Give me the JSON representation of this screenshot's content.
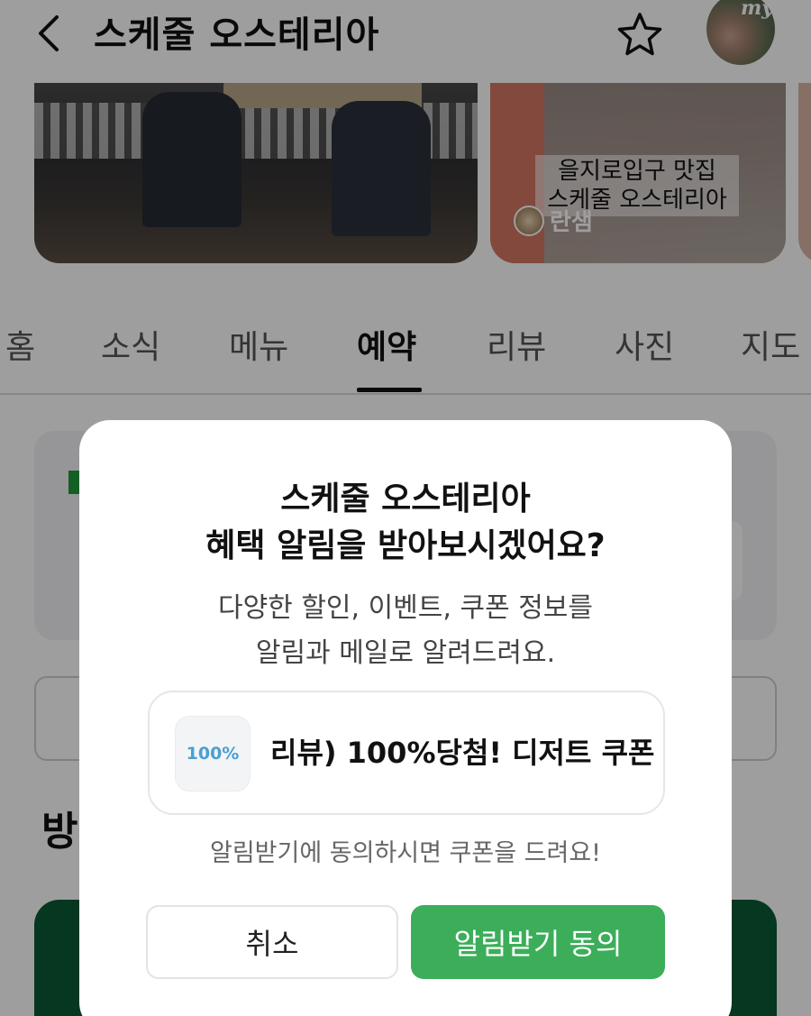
{
  "header": {
    "title": "스케줄 오스테리아",
    "back_icon": "chevron-left-icon",
    "favorite_icon": "star-outline-icon",
    "avatar_badge": "my"
  },
  "gallery": {
    "photo2_caption_line1": "을지로입구 맛집",
    "photo2_caption_line2": "스케줄 오스테리아",
    "photo2_author": "란샘"
  },
  "tabs": [
    {
      "label": "홈"
    },
    {
      "label": "소식"
    },
    {
      "label": "메뉴"
    },
    {
      "label": "예약",
      "active": true
    },
    {
      "label": "리뷰"
    },
    {
      "label": "사진"
    },
    {
      "label": "지도"
    }
  ],
  "background": {
    "partial_heading": "방"
  },
  "modal": {
    "title_line1": "스케줄 오스테리아",
    "title_line2": "혜택 알림을 받아보시겠어요?",
    "desc_line1": "다양한 할인, 이벤트, 쿠폰 정보를",
    "desc_line2": "알림과 메일로 알려드려요.",
    "coupon_icon_text": "100%",
    "coupon_label": "리뷰) 100%당첨! 디저트 쿠폰",
    "note": "알림받기에 동의하시면 쿠폰을 드려요!",
    "cancel_label": "취소",
    "agree_label": "알림받기 동의"
  },
  "colors": {
    "agree_button": "#3cae5a",
    "coupon_icon_text": "#4a9fd3",
    "dimmer": "rgba(0,0,0,0.38)"
  }
}
